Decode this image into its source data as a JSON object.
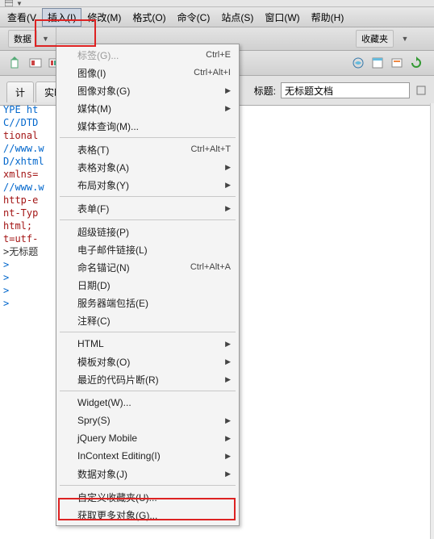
{
  "menubar": {
    "items": [
      {
        "label": "查看(V"
      },
      {
        "label": "插入(I)",
        "active": true
      },
      {
        "label": "修改(M)"
      },
      {
        "label": "格式(O)"
      },
      {
        "label": "命令(C)"
      },
      {
        "label": "站点(S)"
      },
      {
        "label": "窗口(W)"
      },
      {
        "label": "帮助(H)"
      }
    ]
  },
  "toolbar": {
    "left_label": "数据"
  },
  "tabs": {
    "items": [
      "计",
      "实时"
    ]
  },
  "title_section": {
    "label": "标题:",
    "value": "无标题文档"
  },
  "menu": {
    "items": [
      {
        "label": "标签(G)...",
        "shortcut": "Ctrl+E",
        "disabled": true
      },
      {
        "label": "图像(I)",
        "shortcut": "Ctrl+Alt+I"
      },
      {
        "label": "图像对象(G)",
        "submenu": true
      },
      {
        "label": "媒体(M)",
        "submenu": true
      },
      {
        "label": "媒体查询(M)..."
      },
      {
        "sep": true
      },
      {
        "label": "表格(T)",
        "shortcut": "Ctrl+Alt+T"
      },
      {
        "label": "表格对象(A)",
        "submenu": true
      },
      {
        "label": "布局对象(Y)",
        "submenu": true
      },
      {
        "sep": true
      },
      {
        "label": "表单(F)",
        "submenu": true
      },
      {
        "sep": true
      },
      {
        "label": "超级链接(P)"
      },
      {
        "label": "电子邮件链接(L)"
      },
      {
        "label": "命名锚记(N)",
        "shortcut": "Ctrl+Alt+A"
      },
      {
        "label": "日期(D)"
      },
      {
        "label": "服务器端包括(E)"
      },
      {
        "label": "注释(C)"
      },
      {
        "sep": true
      },
      {
        "label": "HTML",
        "submenu": true
      },
      {
        "label": "模板对象(O)",
        "submenu": true
      },
      {
        "label": "最近的代码片断(R)",
        "submenu": true
      },
      {
        "sep": true
      },
      {
        "label": "Widget(W)..."
      },
      {
        "label": "Spry(S)",
        "submenu": true
      },
      {
        "label": "jQuery Mobile",
        "submenu": true
      },
      {
        "label": "InContext Editing(I)",
        "submenu": true
      },
      {
        "label": "数据对象(J)",
        "submenu": true
      },
      {
        "sep": true
      },
      {
        "label": "自定义收藏夹(U)..."
      },
      {
        "label": "获取更多对象(G)..."
      }
    ]
  },
  "code": {
    "lines": [
      "YPE ht",
      "C//DTD",
      "tional",
      "//www.w",
      "D/xhtml",
      "",
      "xmlns=",
      "//www.w",
      "",
      "",
      "http-e",
      "nt-Typ",
      "html;",
      "t=utf-",
      ">无标题",
      ">",
      "",
      ">",
      ">",
      ">"
    ]
  },
  "toolbar2": {
    "right_label": "收藏夹"
  }
}
